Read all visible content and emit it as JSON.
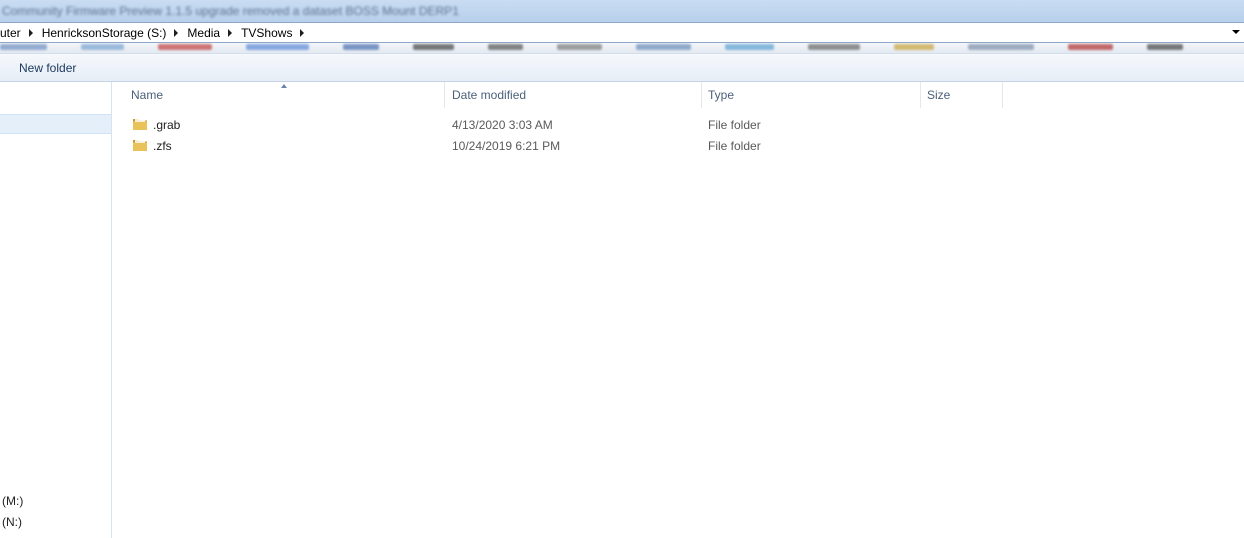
{
  "window": {
    "title": "Community Firmware Preview 1.1.5 upgrade removed a dataset BOSS Mount DERP1"
  },
  "address": {
    "crumbs": [
      "uter",
      "HenricksonStorage (S:)",
      "Media",
      "TVShows"
    ]
  },
  "favorites_bar": {
    "colors": [
      "#6e8fc0",
      "#7aa4cf",
      "#c04040",
      "#5a8ad8",
      "#4a6fb0",
      "#444444",
      "#555555",
      "#7a7a7a",
      "#6a8cb8",
      "#5aa0d0",
      "#666666",
      "#c9a23a",
      "#7d8fa8",
      "#b03030",
      "#444444"
    ]
  },
  "toolbar": {
    "new_folder_label": "New folder"
  },
  "nav": {
    "drives": [
      {
        "label": "(M:)"
      },
      {
        "label": "(N:)"
      }
    ]
  },
  "columns": {
    "name": "Name",
    "date_modified": "Date modified",
    "type": "Type",
    "size": "Size"
  },
  "files": [
    {
      "name": ".grab",
      "date_modified": "4/13/2020 3:03 AM",
      "type": "File folder",
      "size": ""
    },
    {
      "name": ".zfs",
      "date_modified": "10/24/2019 6:21 PM",
      "type": "File folder",
      "size": ""
    }
  ],
  "colors": {
    "folder_fill": "#e9c35a",
    "folder_dark": "#c99a2e",
    "selection": "#e5eff9"
  }
}
